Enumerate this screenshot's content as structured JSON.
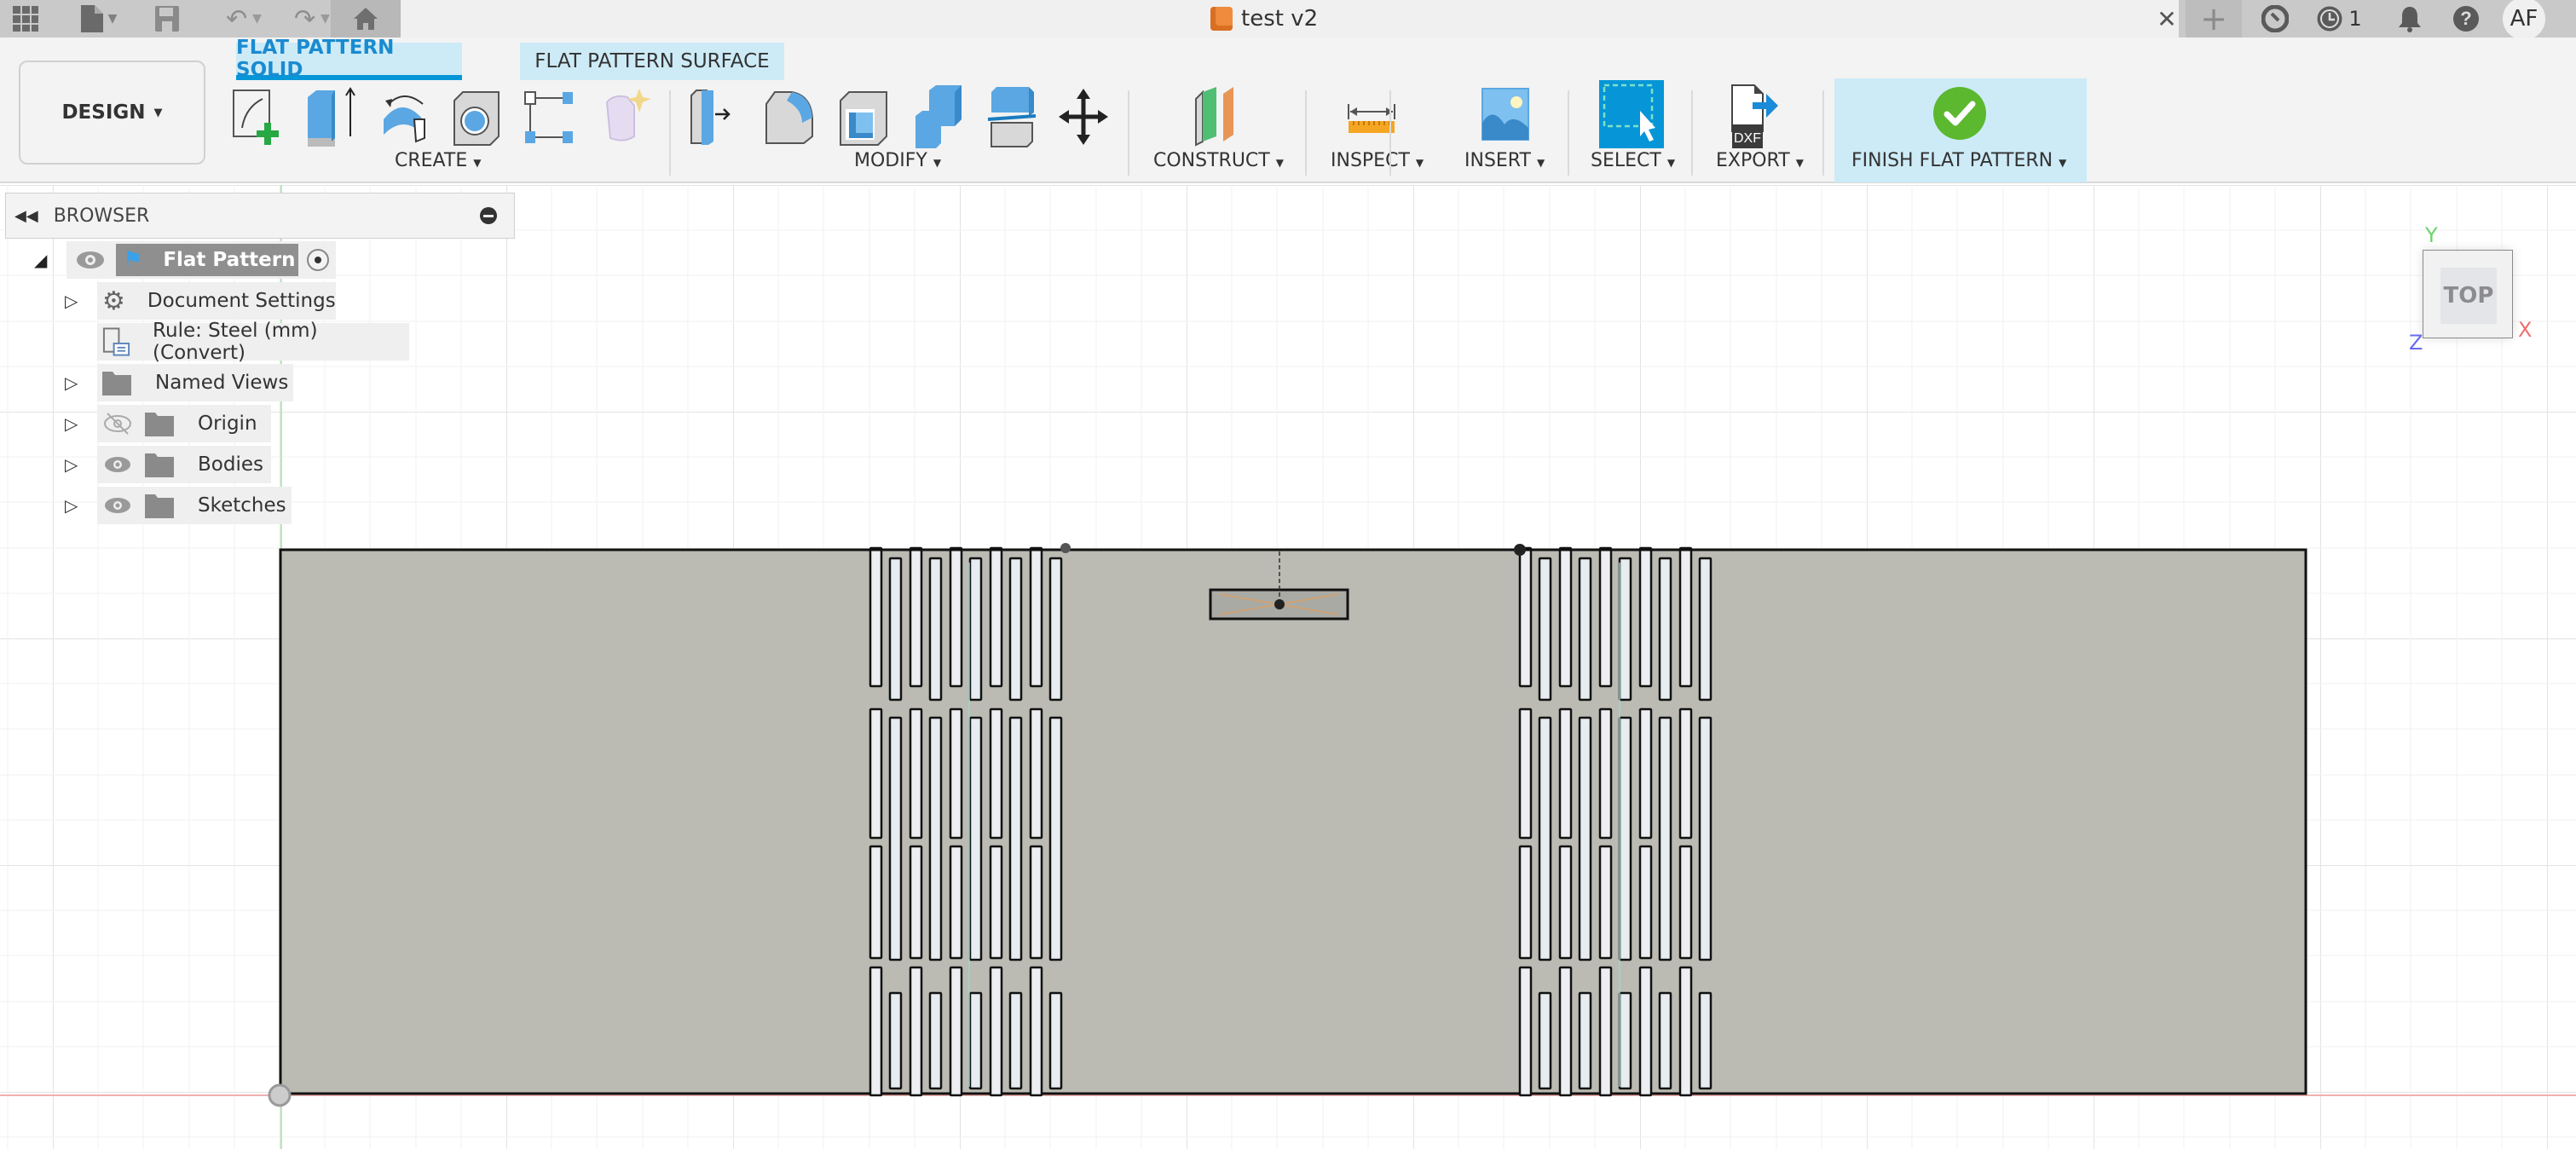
{
  "app": {
    "document_title": "test v2",
    "job_status_count": "1",
    "user_initials": "AF"
  },
  "quick_access": {
    "icons": [
      "grid-menu-icon",
      "file-icon",
      "save-icon",
      "undo-icon",
      "redo-icon",
      "home-icon"
    ]
  },
  "ribbon": {
    "workspace": "DESIGN",
    "tabs": [
      {
        "label": "FLAT PATTERN SOLID",
        "active": true
      },
      {
        "label": "FLAT PATTERN SURFACE",
        "active": false
      }
    ],
    "groups": {
      "create": "CREATE",
      "modify": "MODIFY",
      "construct": "CONSTRUCT",
      "inspect": "INSPECT",
      "insert": "INSERT",
      "select": "SELECT",
      "export": "EXPORT",
      "finish": "FINISH FLAT PATTERN"
    },
    "export_icon_text": "DXF"
  },
  "browser": {
    "title": "BROWSER",
    "root": "Flat Pattern",
    "items": [
      {
        "label": "Document Settings",
        "icon": "gear-icon",
        "expandable": true
      },
      {
        "label": "Rule: Steel (mm) (Convert)",
        "icon": "rule-icon",
        "expandable": false
      },
      {
        "label": "Named Views",
        "icon": "folder-icon",
        "expandable": true
      },
      {
        "label": "Origin",
        "icon": "folder-icon",
        "expandable": true,
        "visibility": "hidden"
      },
      {
        "label": "Bodies",
        "icon": "folder-icon",
        "expandable": true,
        "visibility": "visible"
      },
      {
        "label": "Sketches",
        "icon": "folder-icon",
        "expandable": true,
        "visibility": "visible"
      }
    ]
  },
  "viewcube": {
    "face": "TOP",
    "axes": {
      "x": "X",
      "y": "Y",
      "z": "Z"
    }
  },
  "colors": {
    "accent": "#0696d7",
    "tab_bg": "#cdebf7",
    "part_fill": "#bbbbb3",
    "finish_green": "#5cb82e"
  }
}
